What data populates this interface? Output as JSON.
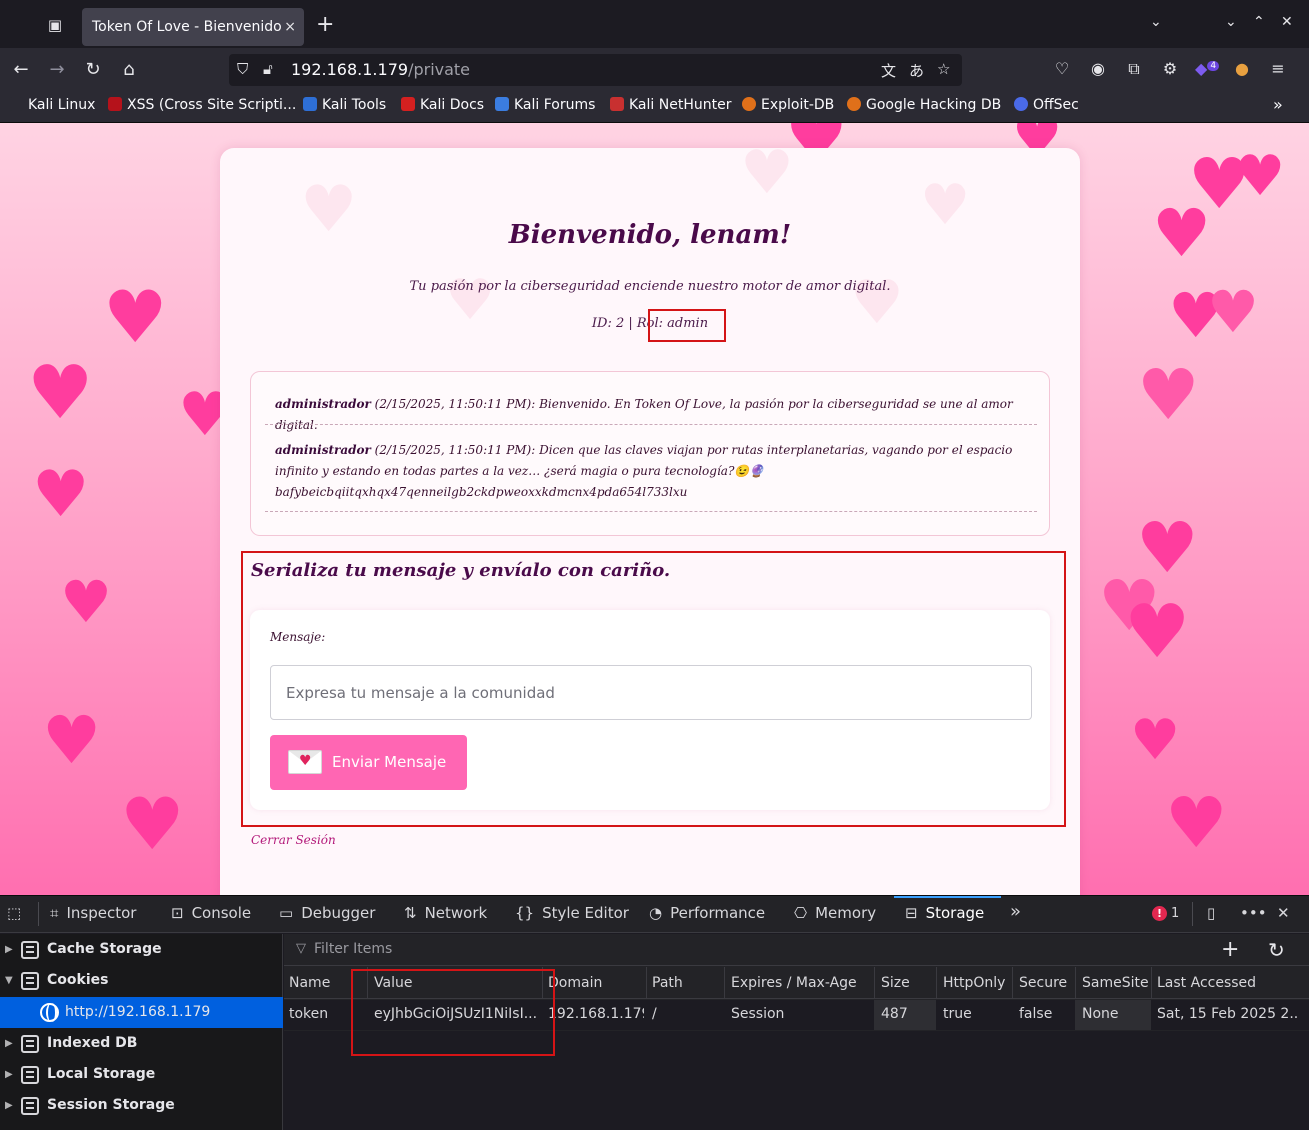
{
  "browser": {
    "tab_title": "Token Of Love - Bienvenido",
    "tab_close": "×",
    "new_tab": "+",
    "url_host": "192.168.1.179",
    "url_path": "/private",
    "bookmarks": [
      "Kali Linux",
      "XSS (Cross Site Scripti...",
      "Kali Tools",
      "Kali Docs",
      "Kali Forums",
      "Kali NetHunter",
      "Exploit-DB",
      "Google Hacking DB",
      "OffSec"
    ],
    "extension_badge": "4"
  },
  "page": {
    "welcome": "Bienvenido, lenam!",
    "tagline": "Tu pasión por la ciberseguridad enciende nuestro motor de amor digital.",
    "id_role": "ID: 2 | Rol: admin",
    "messages": [
      {
        "author": "administrador",
        "text": " (2/15/2025, 11:50:11 PM): Bienvenido. En Token Of Love, la pasión por la ciberseguridad se une al amor digital."
      },
      {
        "author": "administrador",
        "text": " (2/15/2025, 11:50:11 PM): Dicen que las claves viajan por rutas interplanetarias, vagando por el espacio infinito y estando en todas partes a la vez… ¿será magia o pura tecnología?😉🔮",
        "hash": "bafybeicbqiitqxhqx47qenneilgb2ckdpweoxxkdmcnx4pda654l733lxu"
      }
    ],
    "serialize_title": "Serializa tu mensaje y envíalo con cariño.",
    "form_label": "Mensaje:",
    "input_placeholder": "Expresa tu mensaje a la comunidad",
    "send_button": "Enviar Mensaje",
    "logout": "Cerrar Sesión"
  },
  "devtools": {
    "tabs": [
      "Inspector",
      "Console",
      "Debugger",
      "Network",
      "Style Editor",
      "Performance",
      "Memory",
      "Storage"
    ],
    "active_tab": "Storage",
    "error_count": "1",
    "sidebar": [
      "Cache Storage",
      "Cookies",
      "http://192.168.1.179",
      "Indexed DB",
      "Local Storage",
      "Session Storage"
    ],
    "filter_placeholder": "Filter Items",
    "columns": [
      "Name",
      "Value",
      "Domain",
      "Path",
      "Expires / Max-Age",
      "Size",
      "HttpOnly",
      "Secure",
      "SameSite",
      "Last Accessed"
    ],
    "row": {
      "name": "token",
      "value": "eyJhbGciOiJSUzI1NiIsI...",
      "domain": "192.168.1.179",
      "path": "/",
      "expires": "Session",
      "size": "487",
      "httponly": "true",
      "secure": "false",
      "samesite": "None",
      "last_accessed": "Sat, 15 Feb 2025 2..."
    }
  }
}
